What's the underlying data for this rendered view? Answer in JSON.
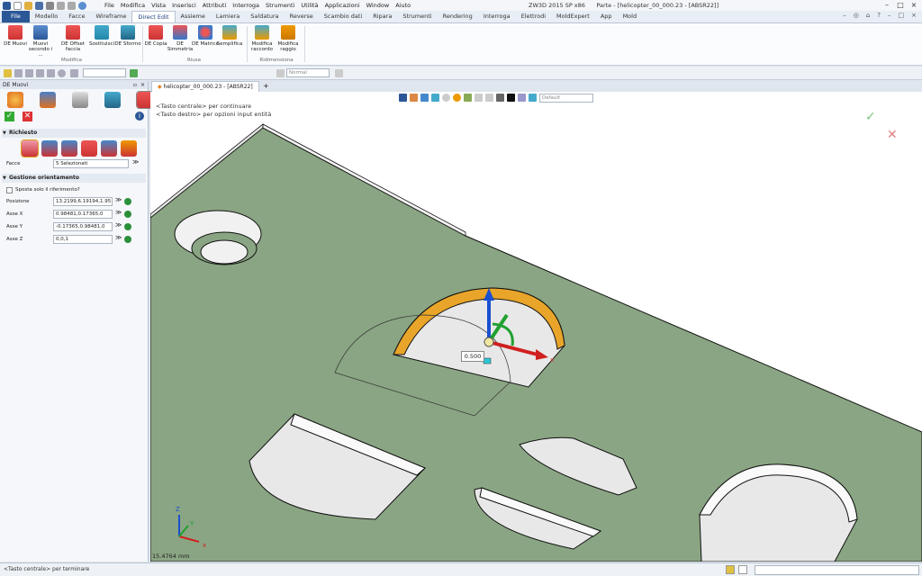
{
  "window": {
    "title": "ZW3D 2015 SP x86",
    "doc_title": "Parte - [helicopter_00_000.23 - [ABSR22]]"
  },
  "menu": [
    "File",
    "Modifica",
    "Vista",
    "Inserisci",
    "Attributi",
    "Interroga",
    "Strumenti",
    "Utilità",
    "Applicazioni",
    "Window",
    "Aiuto"
  ],
  "tabs": [
    "File",
    "Modello",
    "Facce",
    "Wireframe",
    "Direct Edit",
    "Assieme",
    "Lamiera",
    "Saldatura",
    "Reverse",
    "Scambio dati",
    "Ripara",
    "Strumenti",
    "Rendering",
    "Interroga",
    "Elettrodi",
    "MoldExpert",
    "App",
    "Mold"
  ],
  "active_tab": "Direct Edit",
  "ribbon": {
    "buttons": [
      {
        "label": "DE Muovi"
      },
      {
        "label": "Muovi secondo i ..."
      },
      {
        "label": "DE Offset faccia"
      },
      {
        "label": "Sostituisci"
      },
      {
        "label": "DE Sformo"
      },
      {
        "label": "DE Copia"
      },
      {
        "label": "DE Simmetria"
      },
      {
        "label": "DE Matrice"
      },
      {
        "label": "Semplifica"
      },
      {
        "label": "Modifica raccordo"
      },
      {
        "label": "Modifica raggio"
      }
    ],
    "groups": [
      "Modifica",
      "Riusa",
      "Ridimensiona"
    ]
  },
  "toolbar": {
    "style_combo": "Normal",
    "view_combo": "Default"
  },
  "document_tab": "helicopter_00_000.23 - [ABSR22]",
  "panel": {
    "title": "DE Muovi",
    "section_required": "Richiesto",
    "faces_label": "Facce",
    "faces_value": "5 Selezionati",
    "section_orient": "Gestione orientamento",
    "ref_only_label": "Sposta solo il riferimento?",
    "fields": [
      {
        "label": "Posizione",
        "value": "13.2199,6.19194,1.95"
      },
      {
        "label": "Asse X",
        "value": "0.98481,0.17365,0"
      },
      {
        "label": "Asse Y",
        "value": "-0.17365,0.98481,0"
      },
      {
        "label": "Asse Z",
        "value": "0,0,1"
      }
    ]
  },
  "viewport": {
    "hint1": "<Tasto centrale> per continuare",
    "hint2": "<Tasto destro> per opzioni input entità",
    "dimension": "0.500",
    "scale": "15.4764 mm",
    "axis_x": "x",
    "axis_y": "Y",
    "axis_z": "Z"
  },
  "status": "<Tasto centrale> per terminare",
  "colors": {
    "part": "#8aa583",
    "edge": "#111111",
    "highlight": "#e8a52a",
    "accent": "#2b5797"
  }
}
